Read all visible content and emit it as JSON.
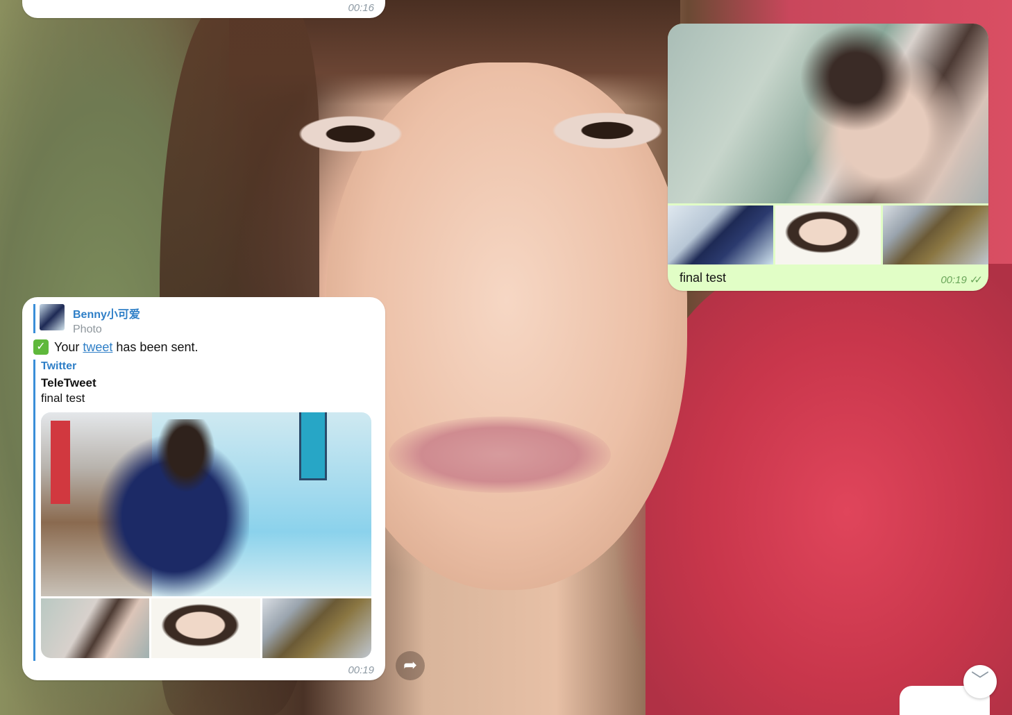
{
  "top_message": {
    "time": "00:16"
  },
  "outgoing_message": {
    "caption": "final test",
    "time": "00:19",
    "status_icon": "double-check-icon",
    "photos": [
      "photo-main",
      "photo-thumb-1",
      "photo-thumb-2",
      "photo-thumb-3"
    ]
  },
  "incoming_message": {
    "reply": {
      "name": "Benny小可爱",
      "subtitle": "Photo"
    },
    "text_prefix": "Your",
    "link_text": "tweet",
    "text_suffix": "has been sent.",
    "status_emoji": "✅",
    "embed": {
      "site": "Twitter",
      "title": "TeleTweet",
      "description": "final test"
    },
    "time": "00:19"
  },
  "controls": {
    "share_icon": "forward-arrow-icon",
    "scroll_icon": "chevron-down-icon",
    "share_glyph": "➦",
    "scroll_glyph": "﹀"
  },
  "colors": {
    "accent": "#2f7fc7",
    "outgoing_bubble": "#e1fec6",
    "incoming_bubble": "#ffffff",
    "check_green": "#5fb83b"
  }
}
